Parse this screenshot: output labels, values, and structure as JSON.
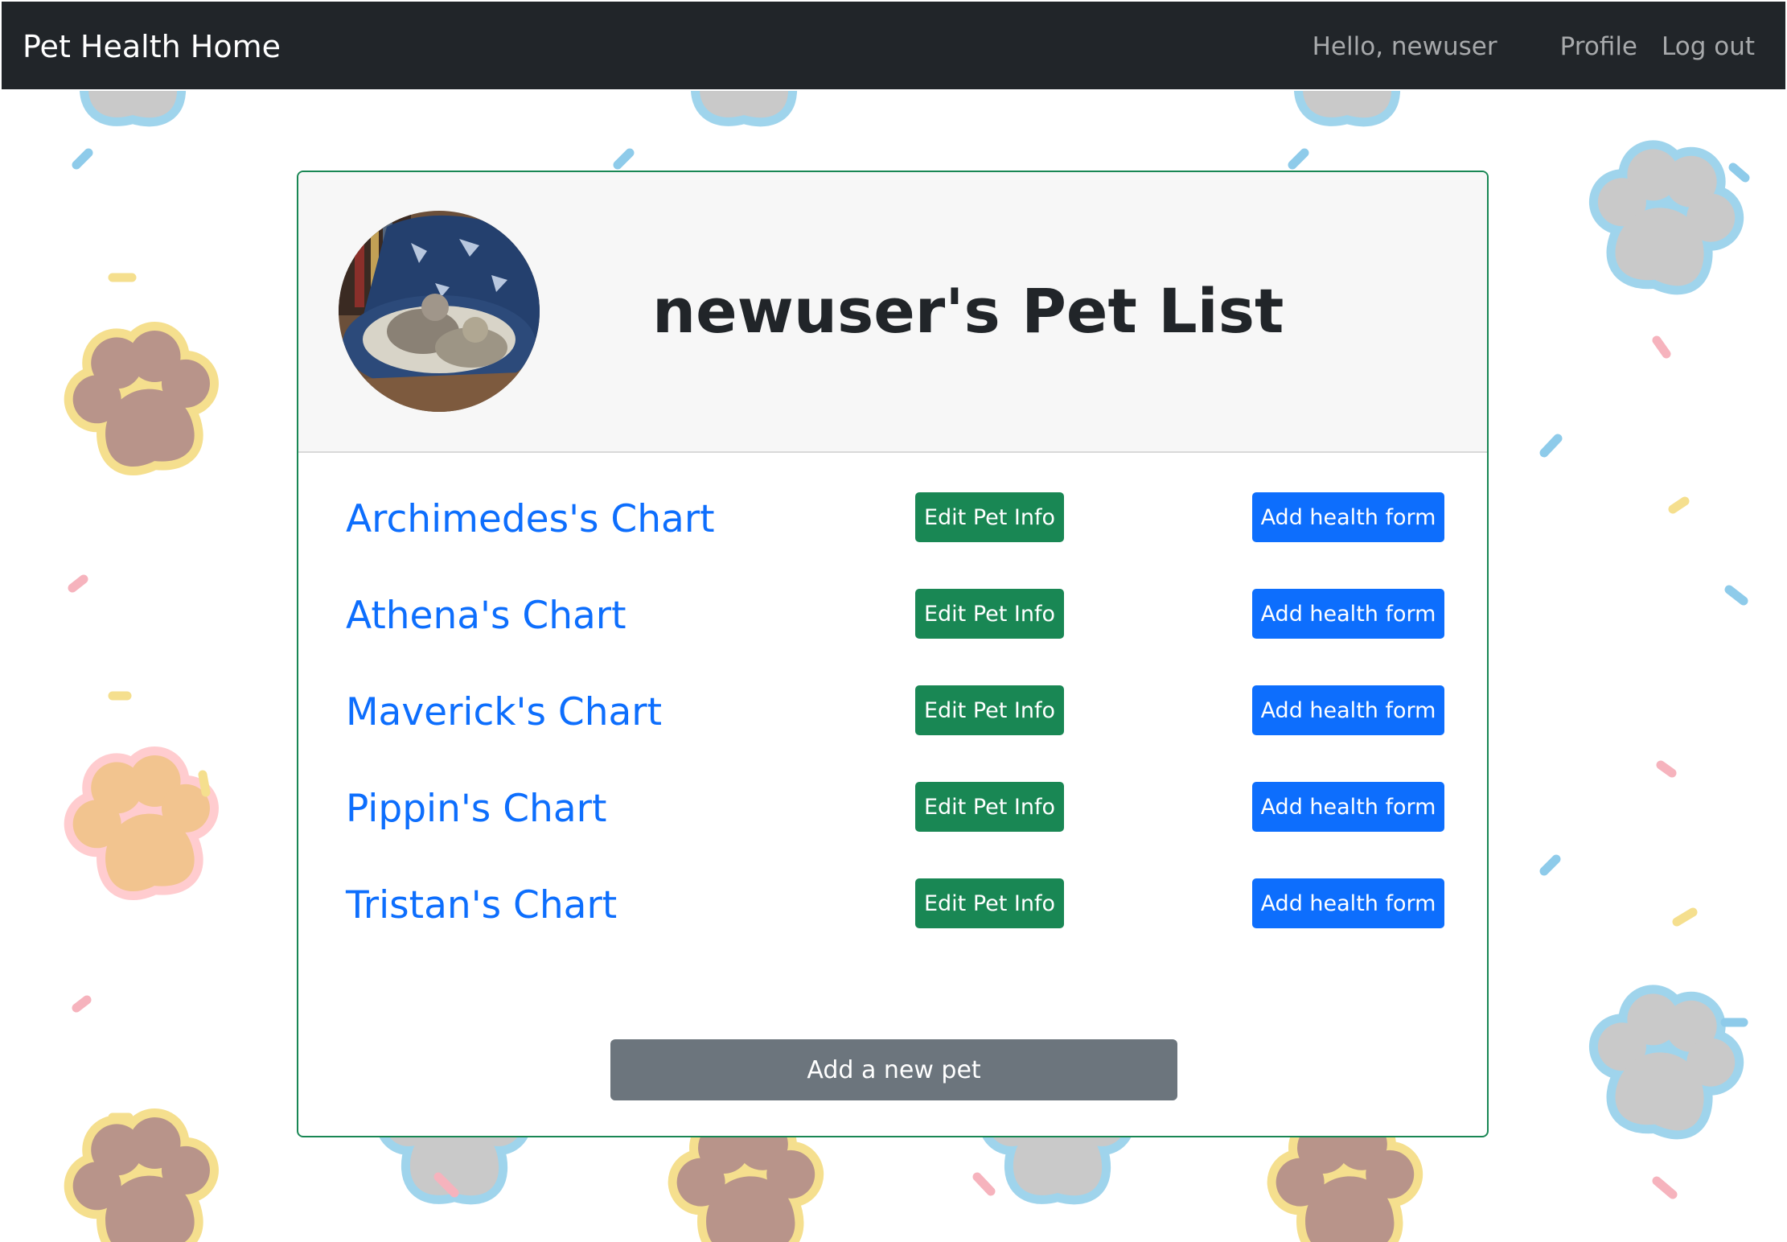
{
  "navbar": {
    "brand": "Pet Health Home",
    "greeting": "Hello, newuser",
    "profile": "Profile",
    "logout": "Log out"
  },
  "card": {
    "title": "newuser's Pet List",
    "pets": [
      {
        "chart_label": "Archimedes's Chart",
        "edit_label": "Edit Pet Info",
        "health_label": "Add health form"
      },
      {
        "chart_label": "Athena's Chart",
        "edit_label": "Edit Pet Info",
        "health_label": "Add health form"
      },
      {
        "chart_label": "Maverick's Chart",
        "edit_label": "Edit Pet Info",
        "health_label": "Add health form"
      },
      {
        "chart_label": "Pippin's Chart",
        "edit_label": "Edit Pet Info",
        "health_label": "Add health form"
      },
      {
        "chart_label": "Tristan's Chart",
        "edit_label": "Edit Pet Info",
        "health_label": "Add health form"
      }
    ],
    "add_pet_label": "Add a new pet"
  },
  "colors": {
    "navbar_bg": "#212529",
    "card_border": "#198754",
    "edit_button": "#198754",
    "health_button": "#0d6efd",
    "add_pet_button": "#6c757d",
    "link": "#0d6efd"
  },
  "icons": {
    "background": "paw-print-pattern"
  }
}
